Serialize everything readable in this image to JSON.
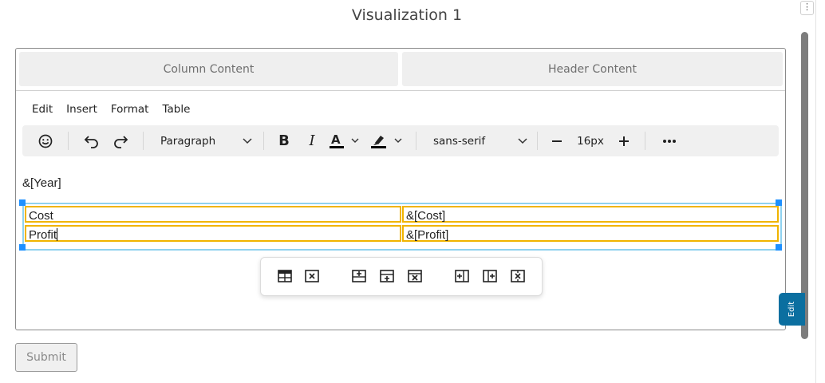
{
  "title": "Visualization 1",
  "tabs": {
    "column": "Column Content",
    "header": "Header Content"
  },
  "menu": [
    "Edit",
    "Insert",
    "Format",
    "Table"
  ],
  "toolbar": {
    "block_format": "Paragraph",
    "font_family": "sans-serif",
    "font_size": "16px",
    "icons": [
      "emoji-icon",
      "undo-icon",
      "redo-icon",
      "chevron-down-icon",
      "bold-icon",
      "italic-icon",
      "text-color-icon",
      "highlight-icon",
      "minus-icon",
      "plus-icon",
      "more-icon"
    ]
  },
  "editor": {
    "year_placeholder": "&[Year]",
    "table": [
      [
        "Cost",
        "&[Cost]"
      ],
      [
        "Profit",
        "&[Profit]"
      ]
    ]
  },
  "table_toolbar_icons": [
    "table-properties-icon",
    "delete-table-icon",
    "insert-row-before-icon",
    "insert-row-after-icon",
    "delete-row-icon",
    "insert-column-before-icon",
    "insert-column-after-icon",
    "delete-column-icon"
  ],
  "submit_label": "Submit",
  "edit_tab_label": "Edit",
  "colors": {
    "accent": "#0b6fa0",
    "cell_border": "#f0b400",
    "selection": "#8fd2f0",
    "handle": "#1e90ff"
  }
}
